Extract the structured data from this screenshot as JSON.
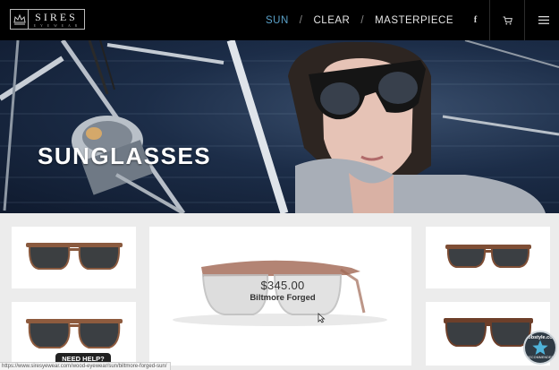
{
  "brand": {
    "name": "SIRES",
    "sub": "E Y E W E A R"
  },
  "nav": {
    "items": [
      {
        "label": "Sun",
        "active": true
      },
      {
        "label": "Clear",
        "active": false
      },
      {
        "label": "Masterpiece",
        "active": false
      }
    ],
    "separator": "/"
  },
  "header_icons": [
    "facebook-icon",
    "cart-icon",
    "menu-icon"
  ],
  "hero": {
    "title": "SUNGLASSES"
  },
  "featured": {
    "price": "$345.00",
    "name": "Biltmore Forged"
  },
  "products": [
    {
      "position": "left-top"
    },
    {
      "position": "left-bottom"
    },
    {
      "position": "right-top"
    },
    {
      "position": "right-bottom"
    }
  ],
  "help_button": "NEED HELP?",
  "status_url": "https://www.siresyewear.com/wood-eyewear/sun/biltmore-forged-sun/",
  "badge": {
    "top": "bobstyle.com",
    "bottom": "RECOMMENDED"
  },
  "colors": {
    "nav_active": "#5aa1c9",
    "topbar": "#000000",
    "page_bg": "#ececec"
  }
}
